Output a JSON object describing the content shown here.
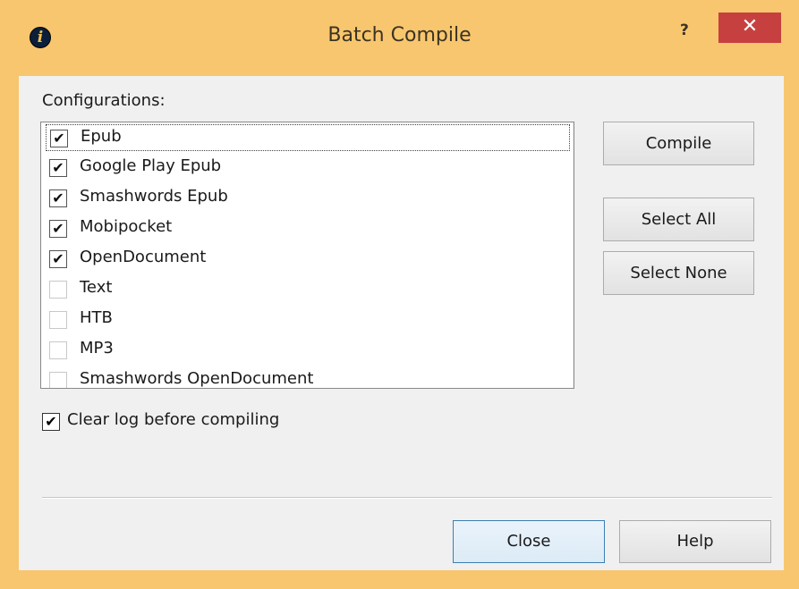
{
  "window": {
    "title": "Batch Compile",
    "help_glyph": "?",
    "close_glyph": "✕",
    "app_icon_glyph": "i",
    "accent_color": "#f8c66e"
  },
  "configurations": {
    "label": "Configurations:",
    "items": [
      {
        "label": "Epub",
        "checked": true,
        "focused": true
      },
      {
        "label": "Google Play Epub",
        "checked": true
      },
      {
        "label": "Smashwords Epub",
        "checked": true
      },
      {
        "label": "Mobipocket",
        "checked": true
      },
      {
        "label": "OpenDocument",
        "checked": true
      },
      {
        "label": "Text",
        "checked": false
      },
      {
        "label": "HTB",
        "checked": false
      },
      {
        "label": "MP3",
        "checked": false
      },
      {
        "label": "Smashwords OpenDocument",
        "checked": false
      }
    ]
  },
  "buttons": {
    "compile": "Compile",
    "select_all": "Select All",
    "select_none": "Select None",
    "close": "Close",
    "help": "Help"
  },
  "options": {
    "clear_log": {
      "label": "Clear log before compiling",
      "checked": true
    }
  },
  "glyphs": {
    "check": "✔",
    "scroll_up": "⌃",
    "scroll_down": "⌄"
  }
}
